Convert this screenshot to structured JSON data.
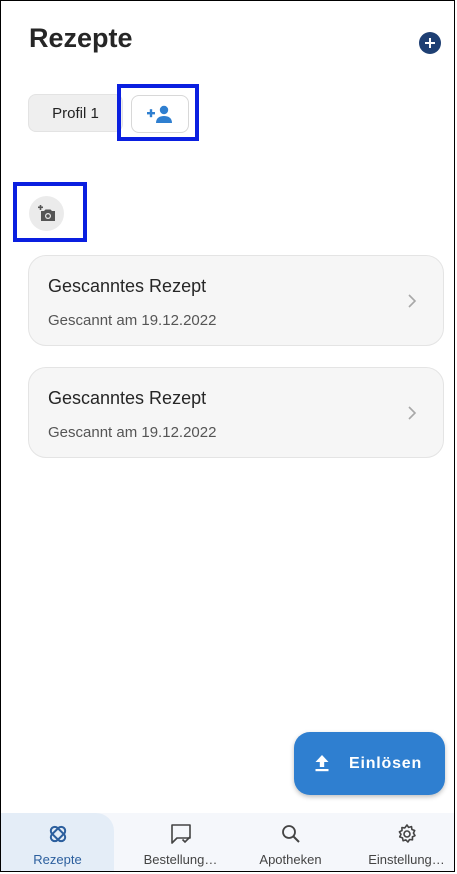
{
  "header": {
    "title": "Rezepte",
    "add_icon": "plus-circle-icon"
  },
  "profiles": {
    "items": [
      {
        "label": "Profil 1"
      }
    ],
    "add_profile_icon": "add-person-icon"
  },
  "camera": {
    "icon": "add-camera-icon"
  },
  "prescriptions": [
    {
      "title": "Gescanntes Rezept",
      "subtitle": "Gescannt am 19.12.2022"
    },
    {
      "title": "Gescanntes Rezept",
      "subtitle": "Gescannt am 19.12.2022"
    }
  ],
  "fab": {
    "label": "Einlösen",
    "icon": "upload-icon"
  },
  "bottom_nav": {
    "items": [
      {
        "label": "Rezepte",
        "icon": "prescription-pill-icon",
        "active": true
      },
      {
        "label": "Bestellung…",
        "icon": "message-check-icon",
        "active": false
      },
      {
        "label": "Apotheken",
        "icon": "search-icon",
        "active": false
      },
      {
        "label": "Einstellung…",
        "icon": "gear-icon",
        "active": false
      }
    ]
  },
  "colors": {
    "primary": "#2f7fd0",
    "dark_accent": "#1e3f73",
    "highlight_box": "#0a1fe0",
    "card_bg": "#f6f6f6",
    "nav_active_bg": "#e4edf7"
  }
}
